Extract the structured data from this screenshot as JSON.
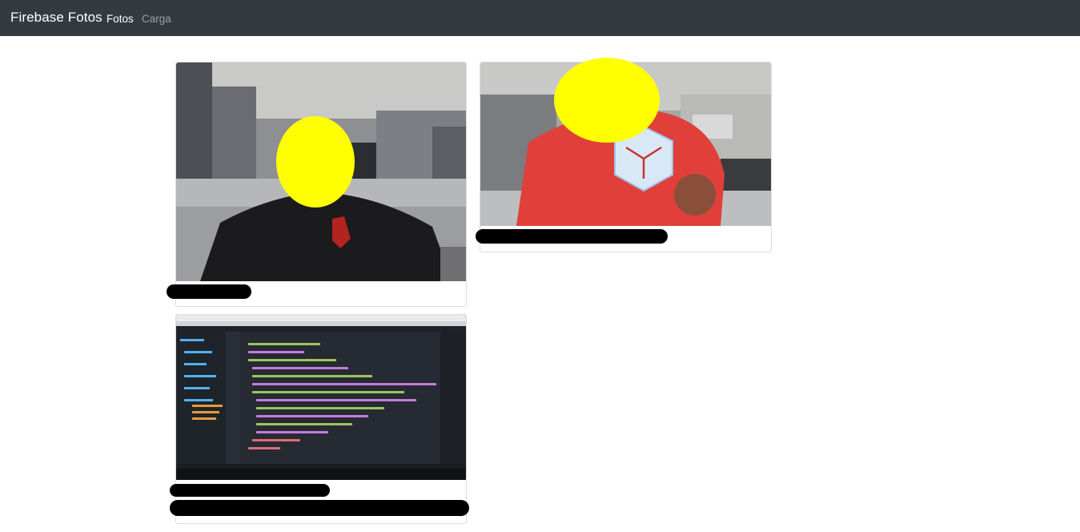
{
  "navbar": {
    "brand": "Firebase Fotos",
    "links": [
      {
        "label": "Fotos",
        "active": true
      },
      {
        "label": "Carga",
        "active": false
      }
    ]
  },
  "colors": {
    "navbar_bg": "#343a40",
    "redaction": "#000000",
    "face_mask": "#ffff00"
  },
  "photos": [
    {
      "title": "",
      "image": "webcam-photo-person-black-shirt"
    },
    {
      "title": "",
      "image": "webcam-photo-person-red-shirt-origami"
    },
    {
      "title": "",
      "image": "screenshot-code-editor"
    }
  ]
}
